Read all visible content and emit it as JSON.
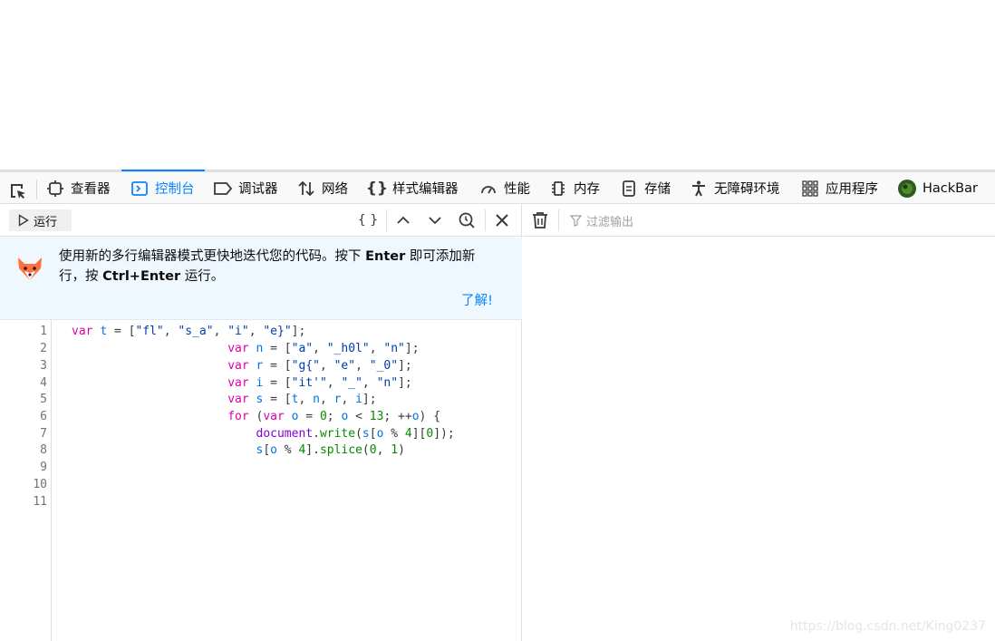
{
  "toolbar": {
    "tabs": [
      {
        "label": "查看器",
        "icon": "inspector-icon"
      },
      {
        "label": "控制台",
        "icon": "console-icon",
        "selected": true
      },
      {
        "label": "调试器",
        "icon": "debugger-icon"
      },
      {
        "label": "网络",
        "icon": "network-icon"
      },
      {
        "label": "样式编辑器",
        "icon": "style-editor-icon"
      },
      {
        "label": "性能",
        "icon": "performance-icon"
      },
      {
        "label": "内存",
        "icon": "memory-icon"
      },
      {
        "label": "存储",
        "icon": "storage-icon"
      },
      {
        "label": "无障碍环境",
        "icon": "accessibility-icon"
      },
      {
        "label": "应用程序",
        "icon": "application-icon"
      },
      {
        "label": "HackBar",
        "icon": "hackbar-icon"
      }
    ]
  },
  "editor": {
    "run_label": "运行",
    "pretty_print_label": "{ }"
  },
  "notice": {
    "text_1": "使用新的多行编辑器模式更快地迭代您的代码。按下 ",
    "enter_key": "Enter",
    "text_2": " 即可添加新行，按 ",
    "ctrl_enter_key": "Ctrl+Enter",
    "text_3": " 运行。",
    "learn_more": "了解!"
  },
  "code": {
    "line_numbers": [
      "1",
      "2",
      "3",
      "4",
      "5",
      "6",
      "7",
      "8",
      "9",
      "10",
      "11"
    ]
  },
  "output": {
    "filter_placeholder": "过滤输出"
  },
  "watermark": "https://blog.csdn.net/King0237",
  "colors": {
    "accent": "#0a84ff",
    "keyword": "#dd00a9",
    "variable": "#0074e8",
    "string": "#003eaa"
  }
}
